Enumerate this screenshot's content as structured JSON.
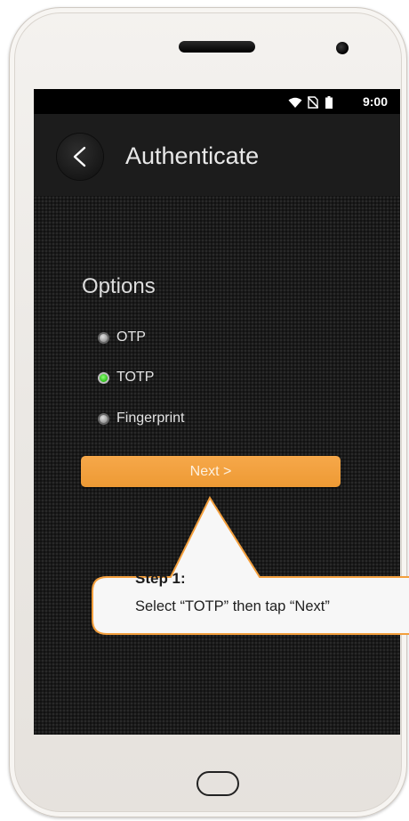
{
  "status_bar": {
    "time": "9:00",
    "icons": [
      "wifi-icon",
      "no-sim-icon",
      "battery-icon"
    ]
  },
  "app_bar": {
    "back_icon": "back-chevron-icon",
    "title": "Authenticate"
  },
  "options": {
    "heading": "Options",
    "items": [
      {
        "label": "OTP",
        "selected": false
      },
      {
        "label": "TOTP",
        "selected": true
      },
      {
        "label": "Fingerprint",
        "selected": false
      }
    ]
  },
  "next_button": {
    "label": "Next >"
  },
  "callout": {
    "step": "Step 1:",
    "text": "Select “TOTP” then tap “Next”"
  },
  "colors": {
    "accent": "#F39F3D",
    "selected_radio": "#2BBD18",
    "callout_bg": "#F7F7F7",
    "callout_border": "#F39F3D"
  }
}
